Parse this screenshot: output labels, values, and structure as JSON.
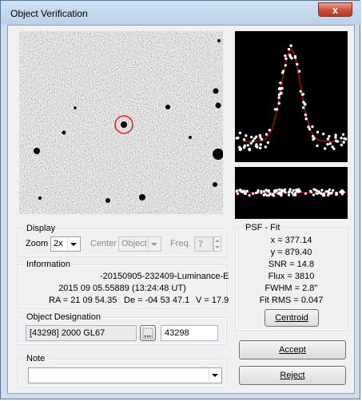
{
  "window": {
    "title": "Object Verification",
    "close_glyph": "x"
  },
  "display": {
    "legend": "Display",
    "zoom_label": "Zoom",
    "zoom_value": "2x",
    "center_label": "Center",
    "center_value": "Object",
    "freq_label": "Freq.",
    "freq_value": "7"
  },
  "information": {
    "legend": "Information",
    "line1": "-20150905-232409-Luminance-E",
    "line2": "2015 09 05.55889 (13:24:48 UT)",
    "ra": "RA = 21 09 54.35",
    "de": "De = -04 53 47.1",
    "v": "V = 17.9"
  },
  "designation": {
    "legend": "Object Designation",
    "name": "[43298] 2000 GL67",
    "browse_icon": "ellipsis-icon",
    "number": "43298"
  },
  "note": {
    "legend": "Note",
    "value": ""
  },
  "psf": {
    "legend": "PSF - Fit",
    "x": "x = 377.14",
    "y": "y = 879.40",
    "snr": "SNR = 14.8",
    "flux": "Flux = 3810",
    "fwhm": "FWHM = 2.8''",
    "rms": "Fit RMS = 0.047",
    "centroid_label": "Centroid"
  },
  "buttons": {
    "accept": "Accept",
    "reject": "Reject"
  },
  "colors": {
    "marker": "#e02020",
    "fit_curve": "#c00000",
    "window_frame": "#cfdcea"
  }
}
